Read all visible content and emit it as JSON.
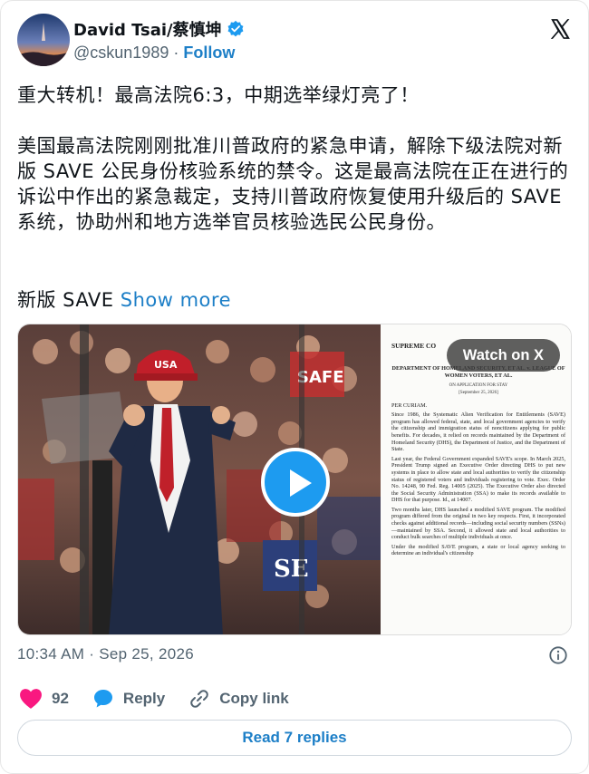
{
  "author": {
    "display_name": "David Tsai/蔡慎坤",
    "handle": "@cskun1989",
    "separator": "·",
    "follow_label": "Follow"
  },
  "tweet": {
    "line1": "重大转机！最高法院6:3，中期选举绿灯亮了！",
    "body": "美国最高法院刚刚批准川普政府的紧急申请，解除下级法院对新版 SAVE 公民身份核验系统的禁令。这是最高法院在正在进行的诉讼中作出的紧急裁定，支持川普政府恢复使用升级后的 SAVE 系统，协助州和地方选举官员核验选民公民身份。",
    "line3": "新版 SAVE",
    "show_more": "Show more"
  },
  "media": {
    "watch_label": "Watch on X",
    "hat_text": "USA",
    "sign1": "SAFE",
    "sign2": "SE",
    "doc": {
      "court_header": "SUPREME CO",
      "case_no": "No. 26A308",
      "parties": "DEPARTMENT OF HOMELAND SECURITY, ET AL. v. LEAGUE OF WOMEN VOTERS, ET AL.",
      "app_line": "ON APPLICATION FOR STAY",
      "date_line": "[September 25, 2026]",
      "per_curiam": "PER CURIAM.",
      "para1": "Since 1986, the Systematic Alien Verification for Entitlements (SAVE) program has allowed federal, state, and local government agencies to verify the citizenship and immigration status of noncitizens applying for public benefits. For decades, it relied on records maintained by the Department of Homeland Security (DHS), the Department of Justice, and the Department of State.",
      "para2": "Last year, the Federal Government expanded SAVE's scope. In March 2025, President Trump signed an Executive Order directing DHS to put new systems in place to allow state and local authorities to verify the citizenship status of registered voters and individuals registering to vote. Exec. Order No. 14248, 90 Fed. Reg. 14005 (2025). The Executive Order also directed the Social Security Administration (SSA) to make its records available to DHS for that purpose. Id., at 14007.",
      "para3": "Two months later, DHS launched a modified SAVE program. The modified program differed from the original in two key respects. First, it incorporated checks against additional records—including social security numbers (SSNs)—maintained by SSA. Second, it allowed state and local authorities to conduct bulk searches of multiple individuals at once.",
      "para4": "Under the modified SAVE program, a state or local agency seeking to determine an individual's citizenship"
    }
  },
  "timestamp": "10:34 AM · Sep 25, 2026",
  "actions": {
    "like_count": "92",
    "reply_label": "Reply",
    "copy_label": "Copy link"
  },
  "read_replies_label": "Read 7 replies",
  "colors": {
    "accent": "#1d9bf0",
    "link": "#1d7fc7",
    "like": "#f91880",
    "muted": "#536471"
  }
}
